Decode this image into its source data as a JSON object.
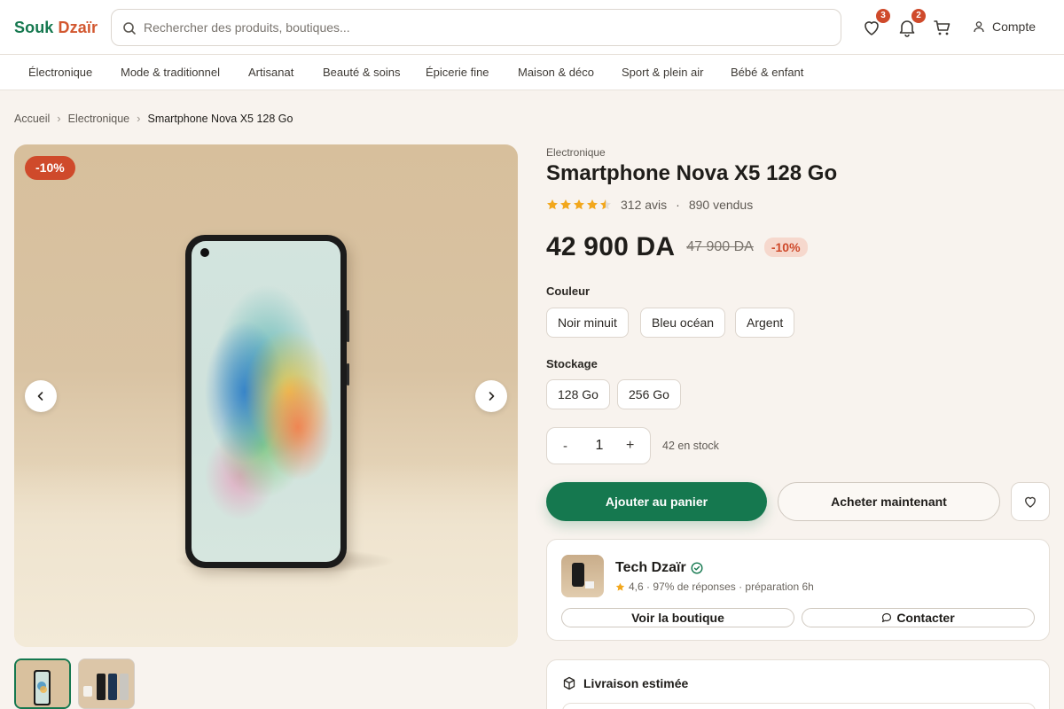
{
  "header": {
    "logo_part1": "Souk",
    "logo_part2": "Dzaïr",
    "search_placeholder": "Rechercher des produits, boutiques...",
    "wishlist_count": "3",
    "notifications_count": "2",
    "account_label": "Compte"
  },
  "categories": [
    "Électronique",
    "Mode & traditionnel",
    "Artisanat",
    "Beauté & soins",
    "Épicerie fine",
    "Maison & déco",
    "Sport & plein air",
    "Bébé & enfant"
  ],
  "breadcrumb": [
    "Accueil",
    "Electronique",
    "Smartphone Nova X5 128 Go"
  ],
  "gallery": {
    "discount_badge": "-10%",
    "thumbnail_count": 2
  },
  "product": {
    "category": "Electronique",
    "title": "Smartphone Nova X5 128 Go",
    "rating": 4.5,
    "reviews": "312 avis",
    "separator": "·",
    "sold": "890 vendus",
    "price": "42 900 DA",
    "old_price": "47 900 DA",
    "discount": "-10%",
    "color_label": "Couleur",
    "colors": [
      "Noir minuit",
      "Bleu océan",
      "Argent"
    ],
    "storage_label": "Stockage",
    "storage": [
      "128 Go",
      "256 Go"
    ],
    "qty_minus": "-",
    "quantity": "1",
    "qty_plus": "+",
    "stock": "42 en stock",
    "add_to_cart": "Ajouter au panier",
    "buy_now": "Acheter maintenant"
  },
  "seller": {
    "name": "Tech Dzaïr",
    "meta": "4,6 · 97% de réponses · préparation 6h",
    "visit_label": "Voir la boutique",
    "contact_label": "Contacter"
  },
  "delivery": {
    "title": "Livraison estimée"
  },
  "colors": {
    "brand_green": "#15784f",
    "brand_orange": "#d2572f",
    "badge_red": "#cf4a2b",
    "star": "#f2a71c",
    "background": "#f8f3ee"
  }
}
